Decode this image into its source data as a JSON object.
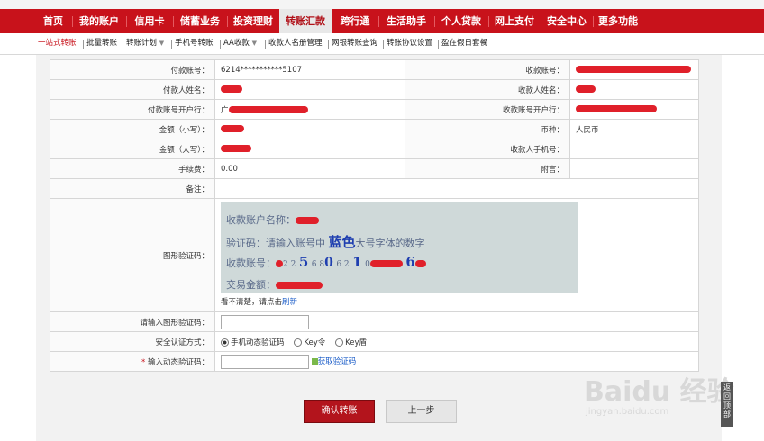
{
  "nav": [
    "首页",
    "我的账户",
    "信用卡",
    "储蓄业务",
    "投资理财",
    "转账汇款",
    "跨行通",
    "生活助手",
    "个人贷款",
    "网上支付",
    "安全中心",
    "更多功能"
  ],
  "subnav": [
    "一站式转账",
    "批量转账",
    "转账计划",
    "手机号转账",
    "AA收款",
    "收款人名册管理",
    "网银转账查询",
    "转账协议设置",
    "盈在假日套餐"
  ],
  "rows": {
    "payer_account_label": "付款账号：",
    "payer_account": "6214***********5107",
    "payee_account_label": "收款账号：",
    "payer_name_label": "付款人姓名：",
    "payee_name_label": "收款人姓名：",
    "payer_bank_label": "付款账号开户行：",
    "payer_bank_prefix": "广",
    "payee_bank_label": "收款账号开户行：",
    "amount_small_label": "金额（小写）：",
    "currency_label": "币种：",
    "currency": "人民币",
    "amount_big_label": "金额（大写）：",
    "payee_phone_label": "收款人手机号：",
    "fee_label": "手续费：",
    "fee": "0.00",
    "postscript_label": "附言：",
    "remark_label": "备注：",
    "captcha_label": "图形验证码：",
    "captcha_line1": "收款账户名称：",
    "captcha_line2a": "验证码：请输入账号中",
    "captcha_line2b": "蓝色",
    "captcha_line2c": "大号字体的数字",
    "captcha_line3": "收款账号：",
    "captcha_digits_a": "2 2",
    "captcha_d1": "5",
    "captcha_digits_b": "6 8",
    "captcha_d2": "0",
    "captcha_digits_c": "6 2",
    "captcha_d3": "1",
    "captcha_digits_d": "0",
    "captcha_d4": "6",
    "captcha_line4": "交易金额：",
    "refresh_text": "看不清楚，请点击",
    "refresh_link": "刷新",
    "enter_captcha_label": "请输入图形验证码：",
    "auth_label": "安全认证方式：",
    "auth_opt1": "手机动态验证码",
    "auth_opt2": "Key令",
    "auth_opt3": "Key盾",
    "dyn_code_label": "输入动态验证码：",
    "required_mark": "*",
    "get_code": "获取验证码"
  },
  "buttons": {
    "confirm": "确认转账",
    "back": "上一步"
  },
  "watermark": {
    "text": "Baidu 经验",
    "url": "jingyan.baidu.com"
  },
  "top_button": "返回顶部"
}
